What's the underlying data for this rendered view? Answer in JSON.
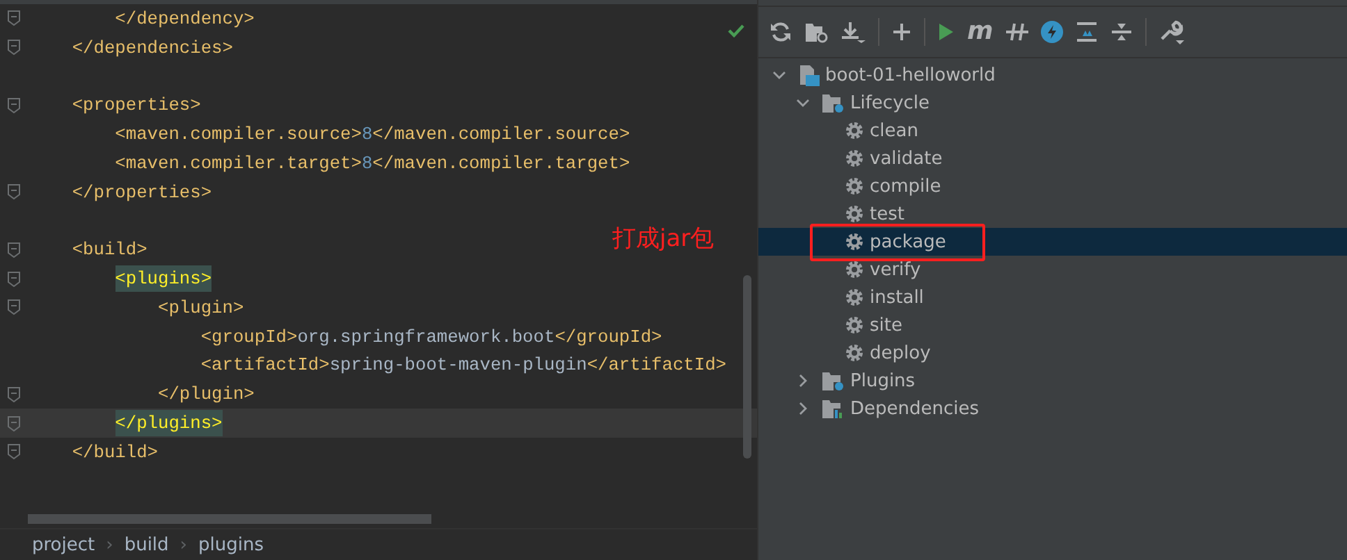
{
  "editor": {
    "lines": [
      {
        "fold": true,
        "current": false,
        "segments": [
          {
            "kind": "tag",
            "text": "        </dependency>"
          }
        ]
      },
      {
        "fold": true,
        "current": false,
        "segments": [
          {
            "kind": "tag",
            "text": "    </dependencies>"
          }
        ]
      },
      {
        "fold": false,
        "current": false
      },
      {
        "fold": true,
        "current": false,
        "segments": [
          {
            "kind": "tag",
            "text": "    <properties>"
          }
        ]
      },
      {
        "fold": false,
        "current": false,
        "segments": [
          {
            "kind": "tag",
            "text": "        <maven.compiler.source>"
          },
          {
            "kind": "number",
            "text": "8"
          },
          {
            "kind": "tag",
            "text": "</maven.compiler.source>"
          }
        ]
      },
      {
        "fold": false,
        "current": false,
        "segments": [
          {
            "kind": "tag",
            "text": "        <maven.compiler.target>"
          },
          {
            "kind": "number",
            "text": "8"
          },
          {
            "kind": "tag",
            "text": "</maven.compiler.target>"
          }
        ]
      },
      {
        "fold": true,
        "current": false,
        "segments": [
          {
            "kind": "tag",
            "text": "    </properties>"
          }
        ]
      },
      {
        "fold": false,
        "current": false
      },
      {
        "fold": true,
        "current": false,
        "segments": [
          {
            "kind": "tag",
            "text": "    <build>"
          }
        ]
      },
      {
        "fold": true,
        "current": false,
        "segments": [
          {
            "kind": "matched-tag",
            "text": "        <plugins>"
          }
        ]
      },
      {
        "fold": true,
        "current": false,
        "segments": [
          {
            "kind": "tag",
            "text": "            <plugin>"
          }
        ]
      },
      {
        "fold": false,
        "current": false,
        "segments": [
          {
            "kind": "tag",
            "text": "                <groupId>"
          },
          {
            "kind": "text",
            "text": "org.springframework.boot"
          },
          {
            "kind": "tag",
            "text": "</groupId>"
          }
        ]
      },
      {
        "fold": false,
        "current": false,
        "segments": [
          {
            "kind": "tag",
            "text": "                <artifactId>"
          },
          {
            "kind": "text",
            "text": "spring-boot-maven-plugin"
          },
          {
            "kind": "tag",
            "text": "</artifactId>"
          }
        ]
      },
      {
        "fold": true,
        "current": false,
        "segments": [
          {
            "kind": "tag",
            "text": "            </plugin>"
          }
        ]
      },
      {
        "fold": true,
        "current": true,
        "segments": [
          {
            "kind": "matched-tag",
            "text": "        </plugins>"
          }
        ]
      },
      {
        "fold": true,
        "current": false,
        "segments": [
          {
            "kind": "tag",
            "text": "    </build>"
          }
        ]
      }
    ],
    "annotation": "打成jar包",
    "breadcrumb": {
      "separator": "›",
      "items": [
        "project",
        "build",
        "plugins"
      ]
    }
  },
  "maven": {
    "toolbar": [
      {
        "kind": "refresh"
      },
      {
        "kind": "folder-sync"
      },
      {
        "kind": "download"
      },
      {
        "kind": "separator"
      },
      {
        "kind": "add"
      },
      {
        "kind": "separator"
      },
      {
        "kind": "run"
      },
      {
        "kind": "letter",
        "label": "m"
      },
      {
        "kind": "offline"
      },
      {
        "kind": "lightning"
      },
      {
        "kind": "expand"
      },
      {
        "kind": "collapse"
      },
      {
        "kind": "separator"
      },
      {
        "kind": "wrench"
      }
    ],
    "tree": [
      {
        "label": "boot-01-helloworld",
        "kind": "module",
        "expanded": true,
        "selected": false,
        "children": [
          {
            "label": "Lifecycle",
            "kind": "folder-gear",
            "expanded": true,
            "selected": false,
            "children": [
              {
                "label": "clean",
                "kind": "goal",
                "selected": false,
                "highlighted": false
              },
              {
                "label": "validate",
                "kind": "goal",
                "selected": false,
                "highlighted": false
              },
              {
                "label": "compile",
                "kind": "goal",
                "selected": false,
                "highlighted": false
              },
              {
                "label": "test",
                "kind": "goal",
                "selected": false,
                "highlighted": false
              },
              {
                "label": "package",
                "kind": "goal",
                "selected": true,
                "highlighted": true
              },
              {
                "label": "verify",
                "kind": "goal",
                "selected": false,
                "highlighted": false
              },
              {
                "label": "install",
                "kind": "goal",
                "selected": false,
                "highlighted": false
              },
              {
                "label": "site",
                "kind": "goal",
                "selected": false,
                "highlighted": false
              },
              {
                "label": "deploy",
                "kind": "goal",
                "selected": false,
                "highlighted": false
              }
            ]
          },
          {
            "label": "Plugins",
            "kind": "folder-gear",
            "expanded": false,
            "selected": false
          },
          {
            "label": "Dependencies",
            "kind": "folder-deps",
            "expanded": false,
            "selected": false
          }
        ]
      }
    ]
  }
}
